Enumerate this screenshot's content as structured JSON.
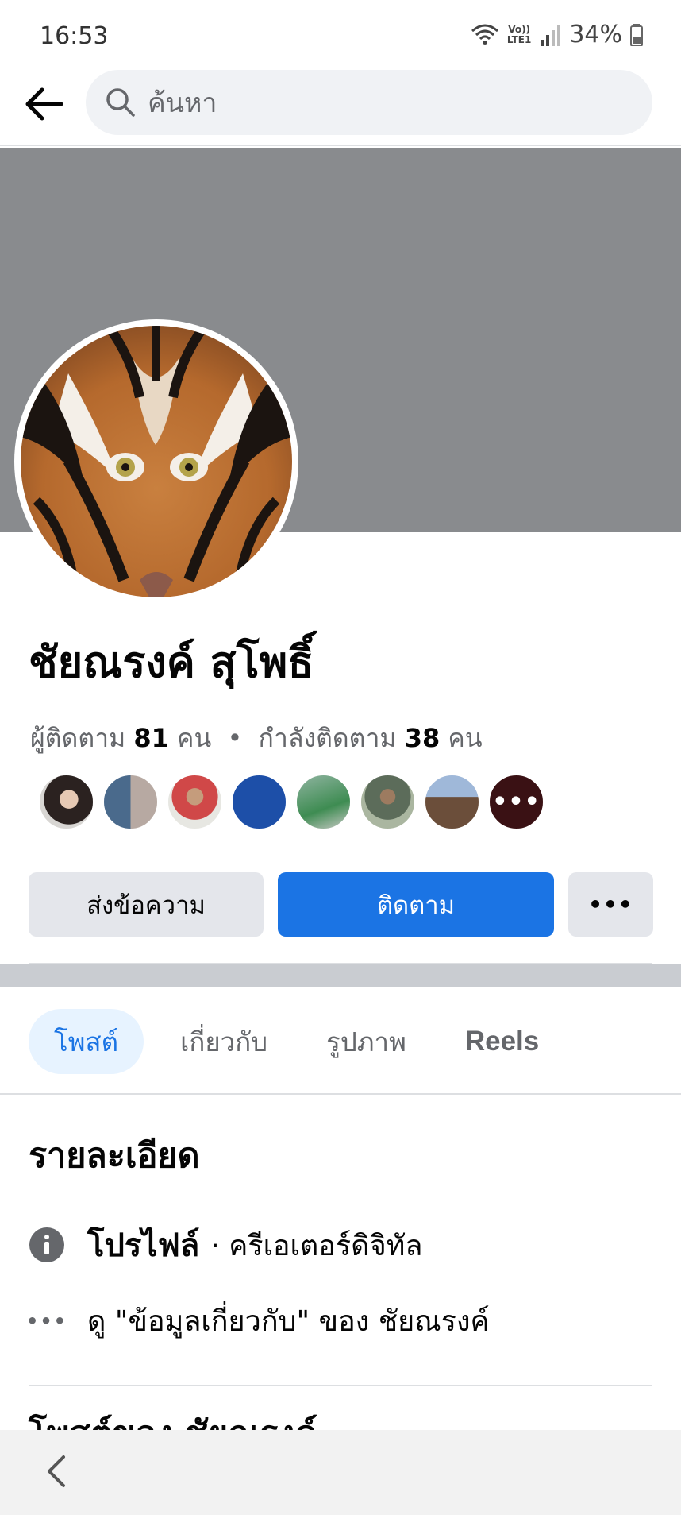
{
  "status_bar": {
    "time": "16:53",
    "network_label_top": "Vo))",
    "network_label_bottom": "LTE1",
    "battery": "34%"
  },
  "search": {
    "placeholder": "ค้นหา"
  },
  "profile": {
    "name": "ชัยณรงค์ สุโพธิ์",
    "followers_label": "ผู้ติดตาม",
    "followers_count": "81",
    "followers_unit": "คน",
    "separator": "•",
    "following_label": "กำลังติดตาม",
    "following_count": "38",
    "following_unit": "คน",
    "more_friends": "•••"
  },
  "actions": {
    "message": "ส่งข้อความ",
    "follow": "ติดตาม",
    "more": "•••"
  },
  "tabs": [
    {
      "label": "โพสต์",
      "active": true
    },
    {
      "label": "เกี่ยวกับ",
      "active": false
    },
    {
      "label": "รูปภาพ",
      "active": false
    },
    {
      "label": "Reels",
      "active": false
    }
  ],
  "details": {
    "title": "รายละเอียด",
    "profile_label": "โปรไฟล์",
    "profile_category": "· ครีเอเตอร์ดิจิทัล",
    "about_link": "ดู \"ข้อมูลเกี่ยวกับ\" ของ ชัยณรงค์",
    "dots": "•••"
  },
  "posts": {
    "title": "โพสต์ของ ชัยณรงค์"
  },
  "colors": {
    "accent": "#1b74e4",
    "cover": "#898b8e",
    "button_gray": "#e4e6eb"
  }
}
